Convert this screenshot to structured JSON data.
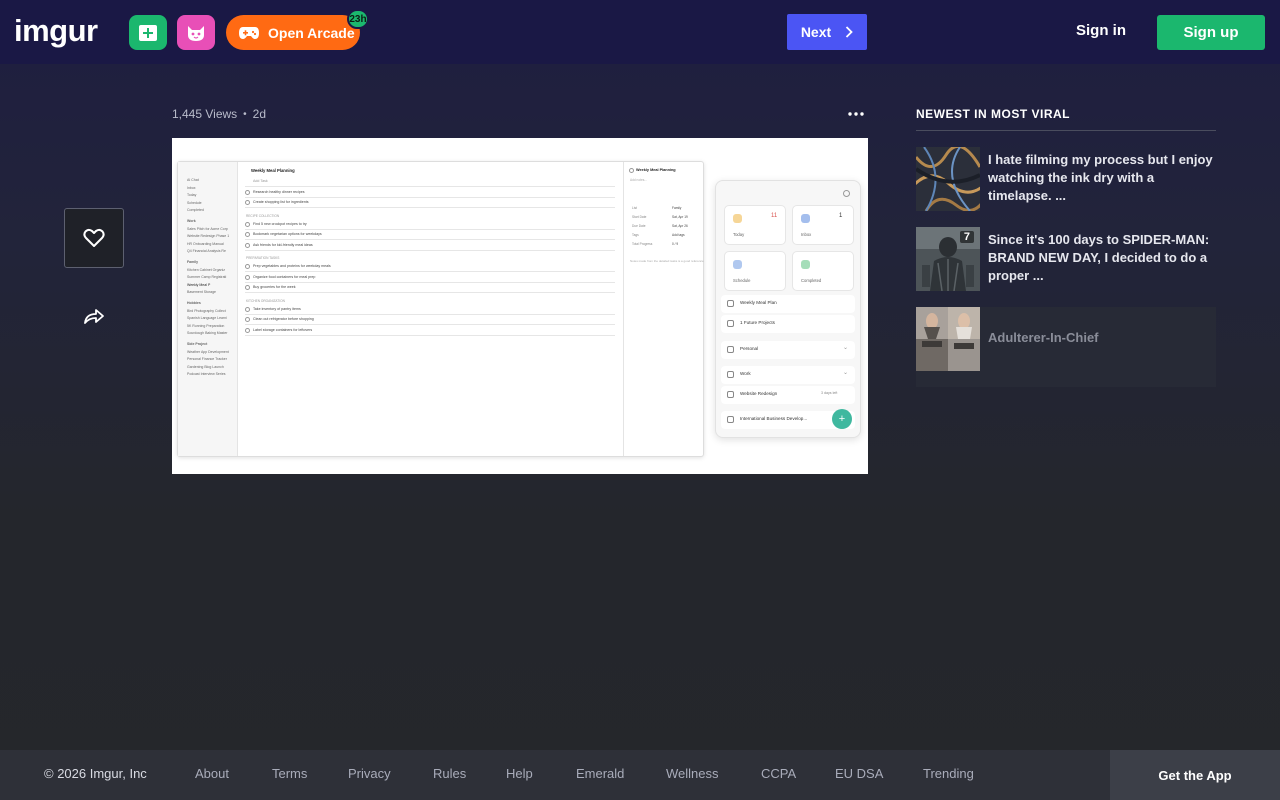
{
  "header": {
    "logo_text": "imgur",
    "arcade_label": "Open Arcade",
    "arcade_badge": "23h",
    "next_label": "Next",
    "signin_label": "Sign in",
    "signup_label": "Sign up"
  },
  "post": {
    "views": "1,445 Views",
    "age": "2d"
  },
  "sidebar": {
    "title": "NEWEST IN MOST VIRAL",
    "items": [
      {
        "title": "I hate filming my process but I enjoy watching the ink dry with a timelapse. ...",
        "count": ""
      },
      {
        "title": "Since it's 100 days to SPIDER-MAN: BRAND NEW DAY, I decided to do a proper ...",
        "count": "7"
      },
      {
        "title": "Adulterer-In-Chief",
        "count": ""
      }
    ]
  },
  "footer": {
    "copyright": "© 2026 Imgur, Inc",
    "links": [
      "About",
      "Terms",
      "Privacy",
      "Rules",
      "Help",
      "Emerald",
      "Wellness",
      "CCPA",
      "EU DSA",
      "Trending"
    ],
    "get_app": "Get the App"
  },
  "embedded": {
    "list_title": "Weekly Meal Planning",
    "sidebar_items": [
      "AI Chat",
      "Inbox",
      "Today",
      "Schedule",
      "Completed",
      "Work",
      "Sales Pitch for Acme Corp",
      "Website Redesign Phase 1",
      "HR Onboarding Manual",
      "Q4 Financial Analysis Re",
      "Family",
      "Kitchen Cabinet Organiz",
      "Summer Camp Registrati",
      "Weekly Meal P",
      "Basement Storage",
      "Hobbies",
      "Bird Photography Collect",
      "Spanish Language Learni",
      "5K Running Preparation",
      "Sourdough Baking Master",
      "Side Project",
      "Weather App Development",
      "Personal Finance Tracker",
      "Gardening Blog Launch",
      "Podcast Interview Series"
    ],
    "tasks": [
      "Add Task",
      "Research healthy dinner recipes",
      "Create shopping list for ingredients",
      "RECIPE COLLECTION",
      "Find 5 new crockpot recipes to try",
      "Bookmark vegetarian options for weekdays",
      "Ask friends for kid-friendly meal ideas",
      "PREPARATION TASKS",
      "Prep vegetables and proteins for weekday meals",
      "Organize food containers for meal prep",
      "Buy groceries for the week",
      "KITCHEN ORGANIZATION",
      "Take inventory of pantry items",
      "Clean out refrigerator before shopping",
      "Label storage containers for leftovers"
    ],
    "detail_title": "Weekly Meal Planning",
    "detail_placeholder": "Add notes...",
    "detail_rows": [
      [
        "List",
        "Family"
      ],
      [
        "Start Date",
        "Sat, Apr 19"
      ],
      [
        "Due Date",
        "Sat, Apr 26"
      ],
      [
        "Tags",
        "Add tags"
      ],
      [
        "Total Progress",
        "0 / 9"
      ]
    ],
    "detail_note": "Notes made from the detailed tasks is a good reference",
    "cards": [
      {
        "label": "Today",
        "count": "11"
      },
      {
        "label": "Inbox",
        "count": "1"
      },
      {
        "label": "Schedule",
        "count": ""
      },
      {
        "label": "Completed",
        "count": ""
      }
    ],
    "panel_items": [
      "Weekly Meal Plan",
      "1 Future Projects",
      "Personal",
      "Work",
      "Website Redesign",
      "International Business Develop..."
    ],
    "days_left": "3 days left"
  }
}
